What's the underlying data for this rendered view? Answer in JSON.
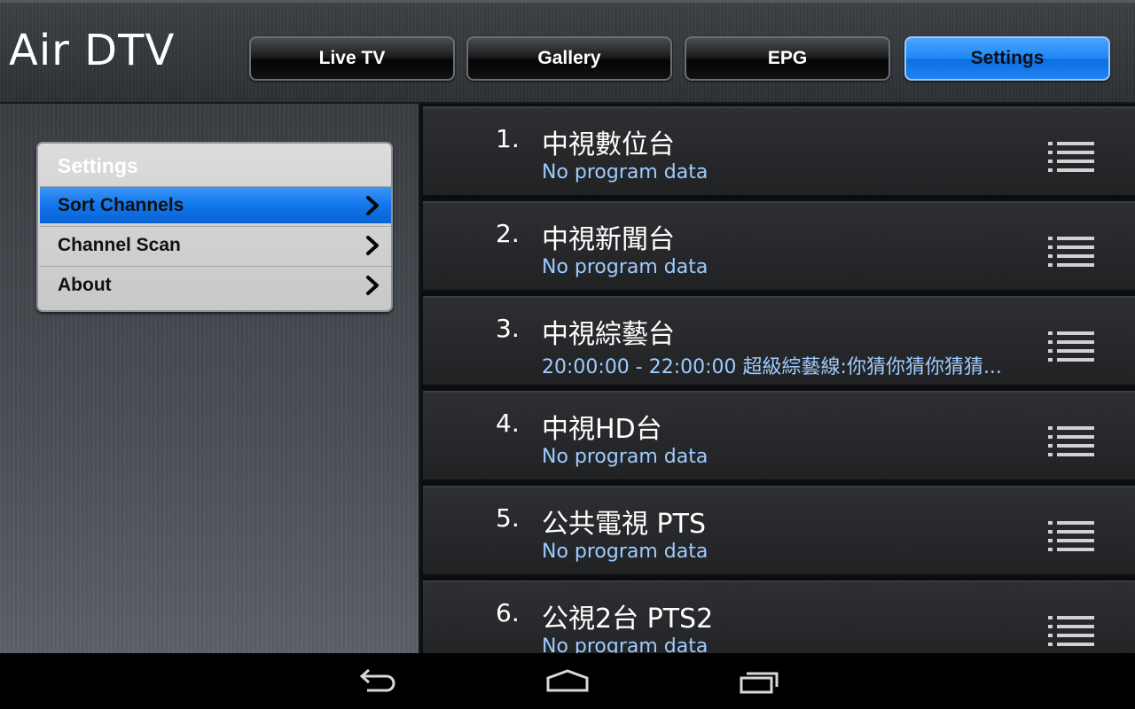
{
  "app": {
    "title": "Air DTV"
  },
  "tabs": [
    {
      "label": "Live TV",
      "active": false
    },
    {
      "label": "Gallery",
      "active": false
    },
    {
      "label": "EPG",
      "active": false
    },
    {
      "label": "Settings",
      "active": true
    }
  ],
  "settings_menu": {
    "title": "Settings",
    "items": [
      {
        "label": "Sort Channels",
        "selected": true,
        "icon": "chevron-right-icon"
      },
      {
        "label": "Channel Scan",
        "selected": false,
        "icon": "chevron-right-icon"
      },
      {
        "label": "About",
        "selected": false,
        "icon": "chevron-right-icon"
      }
    ]
  },
  "channels": [
    {
      "number": "1.",
      "name": "中視數位台",
      "info": "No program data"
    },
    {
      "number": "2.",
      "name": "中視新聞台",
      "info": "No program data"
    },
    {
      "number": "3.",
      "name": "中視綜藝台",
      "info": "20:00:00 - 22:00:00   超級綜藝線:你猜你猜你猜猜..."
    },
    {
      "number": "4.",
      "name": "中視HD台",
      "info": "No program data"
    },
    {
      "number": "5.",
      "name": "公共電視 PTS",
      "info": "No program data"
    },
    {
      "number": "6.",
      "name": "公視2台 PTS2",
      "info": "No program data"
    }
  ],
  "navbar": {
    "buttons": [
      "back-icon",
      "home-icon",
      "recent-apps-icon"
    ]
  },
  "colors": {
    "accent": "#1d86f5",
    "info_text": "#9ecbff"
  }
}
